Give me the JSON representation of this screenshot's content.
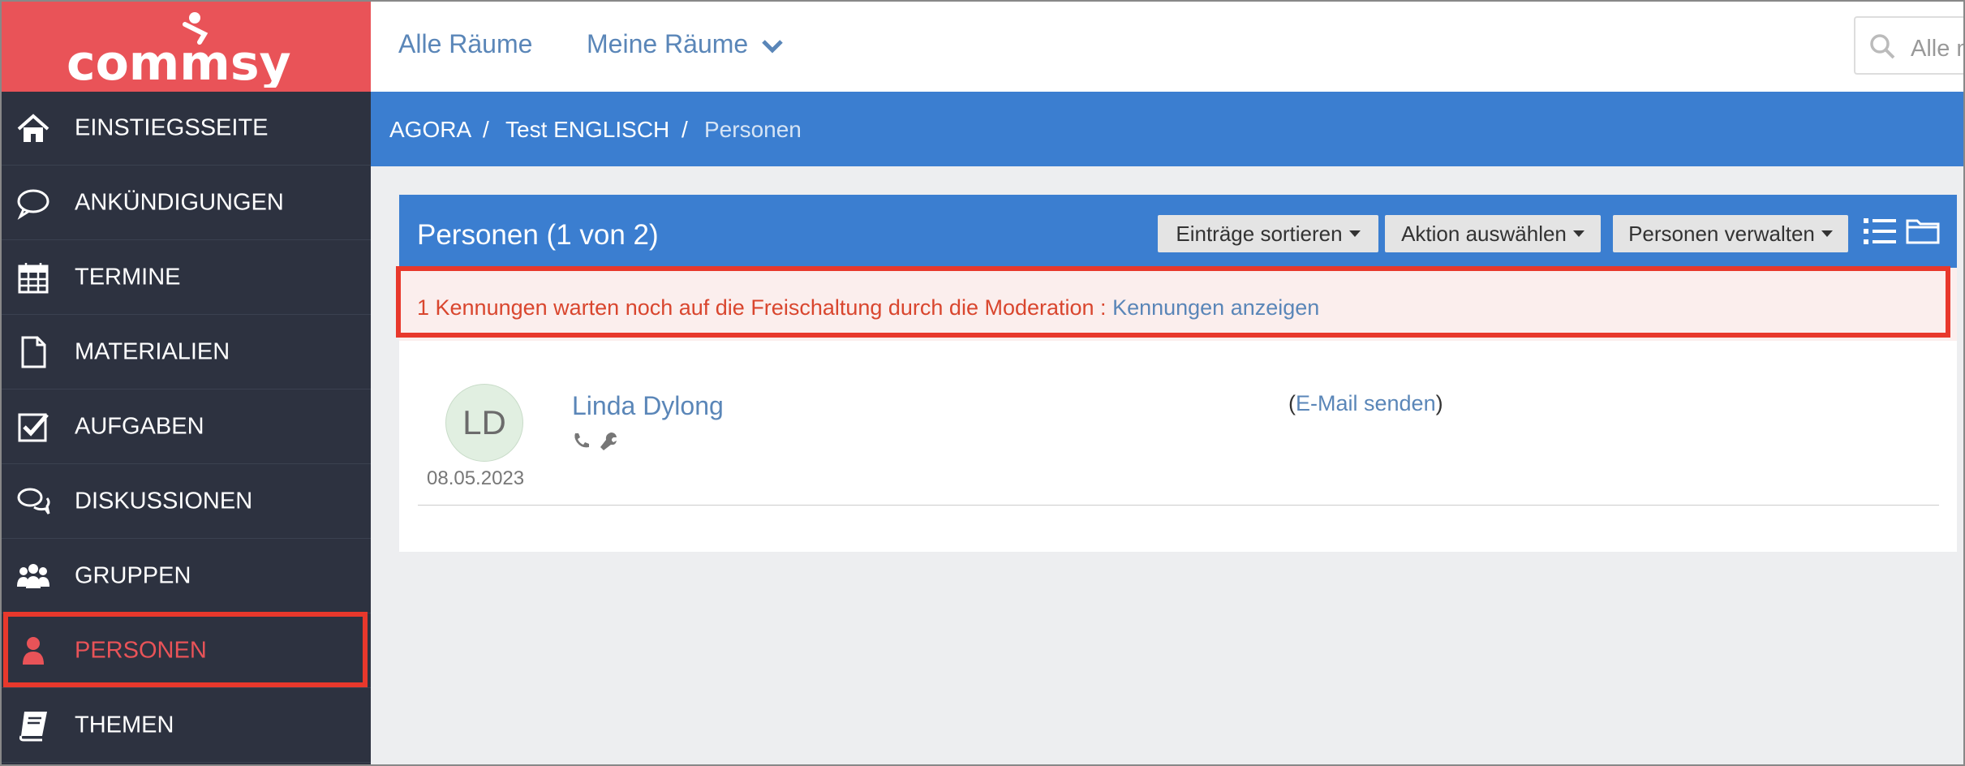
{
  "app": {
    "logo_text": "commsy"
  },
  "sidebar": {
    "items": [
      {
        "label": "EINSTIEGSSEITE",
        "icon": "home-icon"
      },
      {
        "label": "ANKÜNDIGUNGEN",
        "icon": "speech-bubble-icon"
      },
      {
        "label": "TERMINE",
        "icon": "calendar-icon"
      },
      {
        "label": "MATERIALIEN",
        "icon": "document-icon"
      },
      {
        "label": "AUFGABEN",
        "icon": "checkbox-icon"
      },
      {
        "label": "DISKUSSIONEN",
        "icon": "discussion-icon"
      },
      {
        "label": "GRUPPEN",
        "icon": "group-icon"
      },
      {
        "label": "PERSONEN",
        "icon": "person-icon",
        "active": true
      },
      {
        "label": "THEMEN",
        "icon": "book-icon"
      }
    ]
  },
  "topnav": {
    "all_rooms": "Alle Räume",
    "my_rooms": "Meine Räume",
    "search_placeholder": "Alle m"
  },
  "breadcrumb": {
    "items": [
      "AGORA",
      "Test ENGLISCH",
      "Personen"
    ],
    "separator": "/"
  },
  "panel": {
    "title": "Personen (1 von 2)",
    "sort_button": "Einträge sortieren",
    "action_button": "Aktion auswählen",
    "manage_button": "Personen verwalten",
    "alert_text": "1 Kennungen warten noch auf die Freischaltung durch die Moderation : ",
    "alert_link": "Kennungen anzeigen"
  },
  "person": {
    "initials": "LD",
    "name": "Linda Dylong",
    "date": "08.05.2023",
    "mail_link": "E-Mail senden",
    "mail_open": "(",
    "mail_close": ")"
  },
  "colors": {
    "brand_red": "#e95358",
    "sidebar_bg": "#2d3240",
    "primary_blue": "#3b7ed0",
    "link_blue": "#5a86b8",
    "highlight": "#e8382c"
  }
}
